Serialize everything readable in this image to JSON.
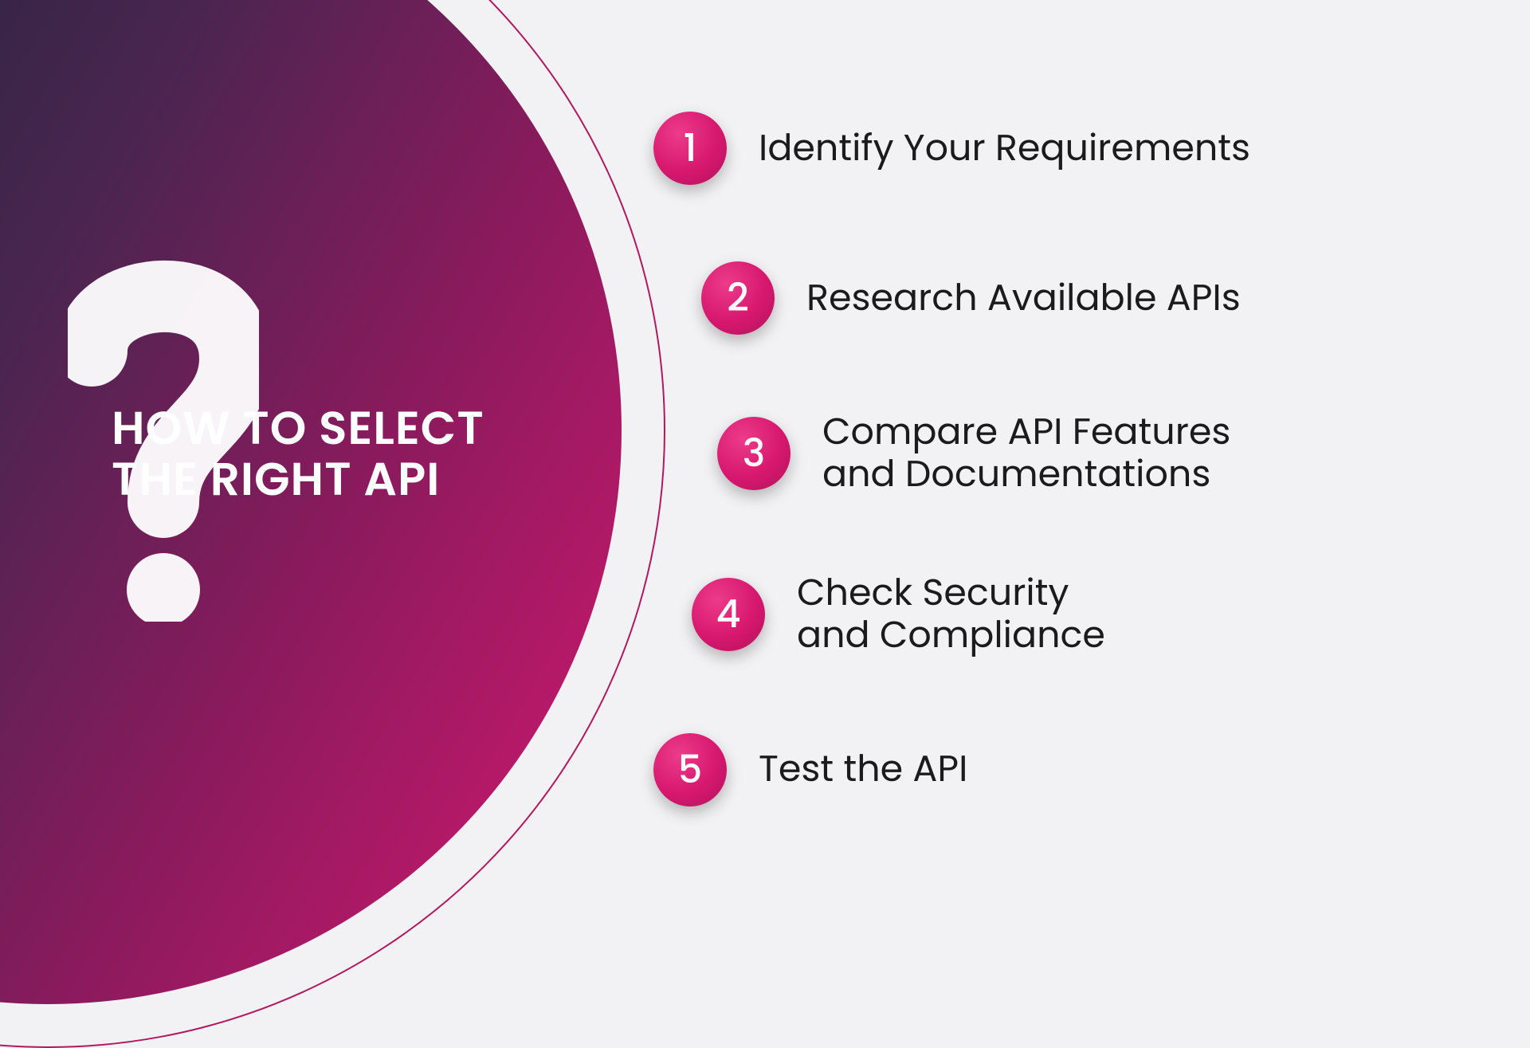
{
  "title_line1": "HOW TO SELECT",
  "title_line2": "THE RIGHT API",
  "question_glyph": "?",
  "steps": [
    {
      "num": "1",
      "label": "Identify Your Requirements"
    },
    {
      "num": "2",
      "label": "Research Available APIs"
    },
    {
      "num": "3",
      "label": "Compare API Features\nand Documentations"
    },
    {
      "num": "4",
      "label": "Check Security\nand Compliance"
    },
    {
      "num": "5",
      "label": "Test the API"
    }
  ],
  "colors": {
    "accent": "#d6186f",
    "dark": "#1e1c2d",
    "bg": "#f2f2f4"
  }
}
